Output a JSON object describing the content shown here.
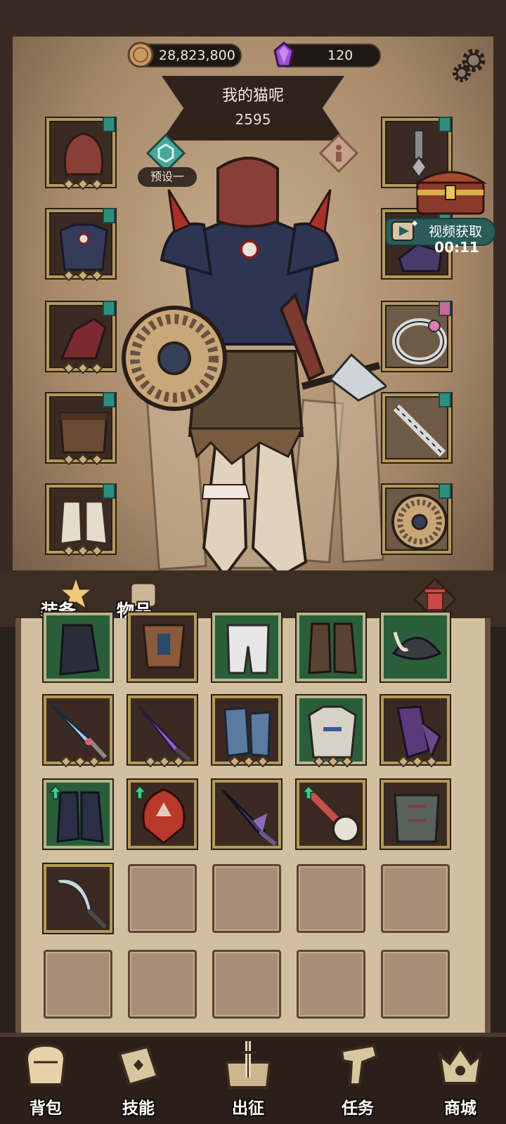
{
  "currency": {
    "coins": "28,823,800",
    "gems": "120"
  },
  "hero": {
    "name": "我的猫呢",
    "power": "2595",
    "preset_label": "预设一"
  },
  "video_reward": {
    "label": "视频获取",
    "timer": "00:11"
  },
  "tabs": {
    "equipment": "装备",
    "items": "物品"
  },
  "equip_left": [
    "helmet",
    "chest-armor",
    "gauntlets",
    "belt-skirt",
    "boots"
  ],
  "equip_right": [
    "amulet",
    "cloak",
    "ring",
    "weapon-mace",
    "shield"
  ],
  "inventory_rows": [
    [
      "greaves",
      "ornate-chest",
      "white-pants",
      "leather-boots",
      "feathered-hat"
    ],
    [
      "ice-sword",
      "purple-dagger",
      "blue-gauntlets",
      "bone-armor",
      "purple-gauntlets"
    ],
    [
      "dark-boots",
      "red-mask",
      "dark-blade",
      "bone-mace",
      "plate-armor"
    ],
    [
      "curved-sword",
      "",
      "",
      "",
      ""
    ],
    [
      "",
      "",
      "",
      "",
      ""
    ]
  ],
  "nav": [
    {
      "label": "背包",
      "icon": "backpack-icon"
    },
    {
      "label": "技能",
      "icon": "skill-book-icon"
    },
    {
      "label": "出征",
      "icon": "sword-map-icon"
    },
    {
      "label": "任务",
      "icon": "scroll-icon"
    },
    {
      "label": "商城",
      "icon": "shop-crown-icon"
    }
  ],
  "colors": {
    "accent_teal": "#2f8f7e",
    "frame_gold": "#b49a58",
    "trash_red": "#c94a48"
  }
}
